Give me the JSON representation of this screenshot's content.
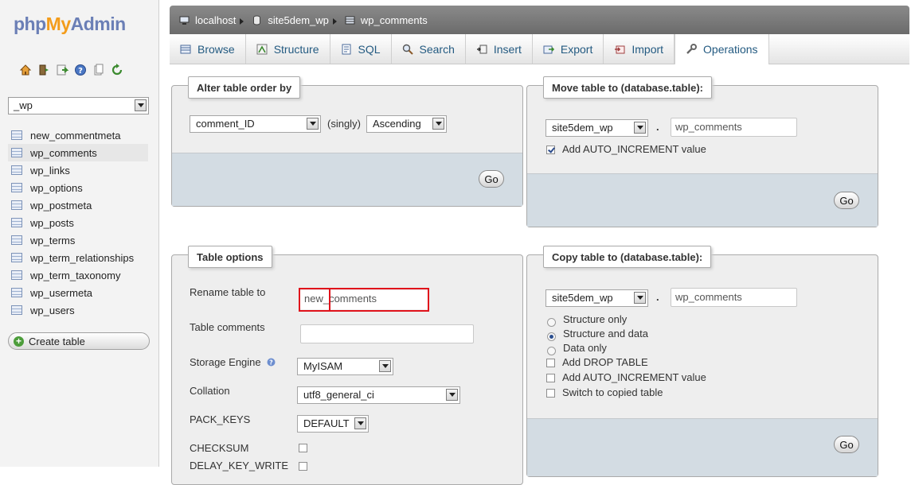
{
  "nav": {
    "logo": {
      "php": "php",
      "my": "My",
      "admin": "Admin"
    },
    "icons": [
      "home-icon",
      "exit-icon",
      "query-icon",
      "help-icon",
      "docs-icon",
      "reload-icon"
    ],
    "database": "_wp",
    "tables": [
      "new_commentmeta",
      "wp_comments",
      "wp_links",
      "wp_options",
      "wp_postmeta",
      "wp_posts",
      "wp_terms",
      "wp_term_relationships",
      "wp_term_taxonomy",
      "wp_usermeta",
      "wp_users"
    ],
    "active_table": "wp_comments",
    "create_table": "Create table"
  },
  "breadcrumb": {
    "server": "localhost",
    "database": "site5dem_wp",
    "table": "wp_comments"
  },
  "tabs": [
    {
      "label": "Browse",
      "icon": "browse-icon"
    },
    {
      "label": "Structure",
      "icon": "structure-icon"
    },
    {
      "label": "SQL",
      "icon": "sql-icon"
    },
    {
      "label": "Search",
      "icon": "search-icon"
    },
    {
      "label": "Insert",
      "icon": "insert-icon"
    },
    {
      "label": "Export",
      "icon": "export-icon"
    },
    {
      "label": "Import",
      "icon": "import-icon"
    },
    {
      "label": "Operations",
      "icon": "wrench-icon"
    }
  ],
  "active_tab": "Operations",
  "alter_order": {
    "title": "Alter table order by",
    "column": "comment_ID",
    "singly": "(singly)",
    "direction": "Ascending",
    "go": "Go"
  },
  "move_table": {
    "title": "Move table to (database.table):",
    "database": "site5dem_wp",
    "dot": ".",
    "table": "wp_comments",
    "auto_increment": "Add AUTO_INCREMENT value",
    "auto_increment_checked": true,
    "go": "Go"
  },
  "table_options": {
    "title": "Table options",
    "rename_label": "Rename table to",
    "rename_value": "new_comments",
    "comments_label": "Table comments",
    "comments_value": "",
    "engine_label": "Storage Engine",
    "engine_value": "MyISAM",
    "collation_label": "Collation",
    "collation_value": "utf8_general_ci",
    "pack_keys_label": "PACK_KEYS",
    "pack_keys_value": "DEFAULT",
    "checksum_label": "CHECKSUM",
    "delay_key_write_label": "DELAY_KEY_WRITE"
  },
  "copy_table": {
    "title": "Copy table to (database.table):",
    "database": "site5dem_wp",
    "dot": ".",
    "table": "wp_comments",
    "options": [
      "Structure only",
      "Structure and data",
      "Data only"
    ],
    "selected_option": "Structure and data",
    "checkboxes": [
      "Add DROP TABLE",
      "Add AUTO_INCREMENT value",
      "Switch to copied table"
    ],
    "go": "Go"
  },
  "colors": {
    "accent_link": "#235a81",
    "highlight_box": "#e0121b",
    "footer_bar": "#d3dce3"
  }
}
